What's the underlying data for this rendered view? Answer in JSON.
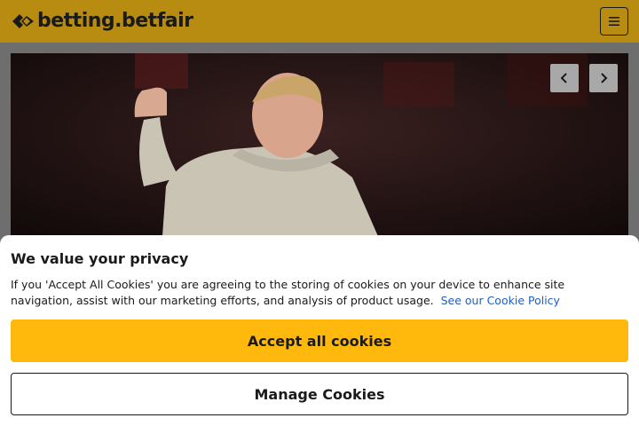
{
  "header": {
    "logo_text": "betting.betfair",
    "logo_icon": "betfair-arrow-logo",
    "menu_icon": "hamburger-icon",
    "background_color": "#b88c10"
  },
  "hero": {
    "image_description_icon": "hero-photo",
    "prev_icon": "chevron-left-icon",
    "next_icon": "chevron-right-icon"
  },
  "cookie_banner": {
    "title": "We value your privacy",
    "body": "If you 'Accept All Cookies' you are agreeing to the storing of cookies on your device to enhance site navigation, assist with our marketing efforts, and analysis of product usage.",
    "link_text": "See our Cookie Policy",
    "accept_label": "Accept all cookies",
    "manage_label": "Manage Cookies",
    "accent_color": "#ffb80c",
    "link_color": "#1f5fbf"
  }
}
